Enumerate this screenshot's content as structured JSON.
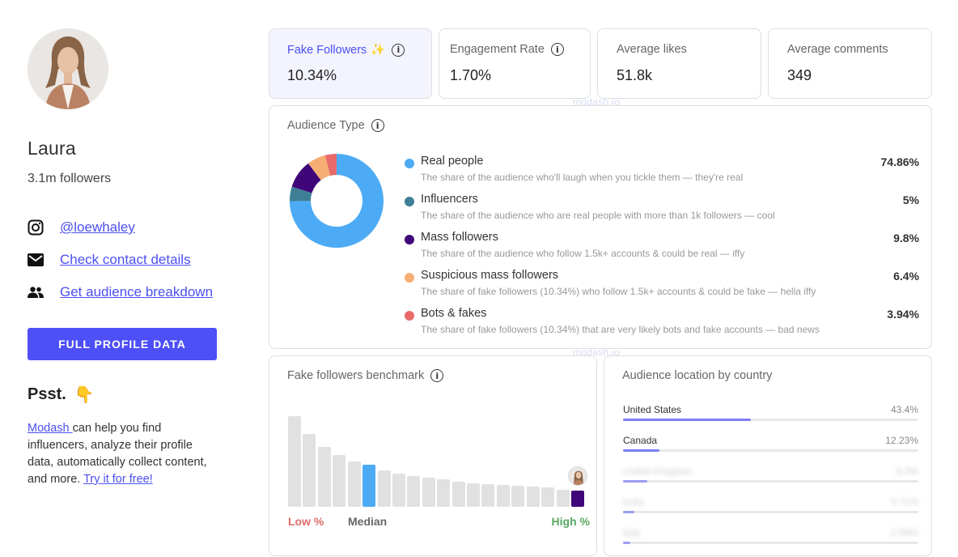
{
  "profile": {
    "name": "Laura",
    "followers": "3.1m followers",
    "instagram_handle": "@loewhaley",
    "contact_link": "Check contact details",
    "audience_link": "Get audience breakdown",
    "cta_label": "FULL PROFILE DATA"
  },
  "promo": {
    "heading": "Psst.",
    "hand_emoji": "👇",
    "brand_link": "Modash ",
    "body": "can help you find influencers, analyze their profile data, automatically collect content, and more. ",
    "try_link": "Try it for free!"
  },
  "stats": [
    {
      "label": "Fake Followers",
      "suffix": "✨",
      "value": "10.34%"
    },
    {
      "label": "Engagement Rate",
      "value": "1.70%"
    },
    {
      "label": "Average likes",
      "value": "51.8k"
    },
    {
      "label": "Average comments",
      "value": "349"
    }
  ],
  "watermark": "modash.io",
  "audience_type": {
    "title": "Audience Type",
    "items": [
      {
        "name": "Real people",
        "desc": "The share of the audience who'll laugh when you tickle them — they're real",
        "pct": "74.86%",
        "value": 74.86,
        "color": "#4dabf5"
      },
      {
        "name": "Influencers",
        "desc": "The share of the audience who are real people with more than 1k followers — cool",
        "pct": "5%",
        "value": 5,
        "color": "#3f7f96"
      },
      {
        "name": "Mass followers",
        "desc": "The share of the audience who follow 1.5k+ accounts & could be real — iffy",
        "pct": "9.8%",
        "value": 9.8,
        "color": "#3f067a"
      },
      {
        "name": "Suspicious mass followers",
        "desc": "The share of fake followers (10.34%) who follow 1.5k+ accounts & could be fake — hella iffy",
        "pct": "6.4%",
        "value": 6.4,
        "color": "#f7ae74"
      },
      {
        "name": "Bots & fakes",
        "desc": "The share of fake followers (10.34%) that are very likely bots and fake accounts — bad news",
        "pct": "3.94%",
        "value": 3.94,
        "color": "#e86a6a"
      }
    ]
  },
  "benchmark": {
    "title": "Fake followers benchmark",
    "low_label": "Low %",
    "median_label": "Median",
    "high_label": "High %",
    "bar_levels": [
      1.0,
      0.8,
      0.66,
      0.57,
      0.5,
      0.44,
      0.4,
      0.37,
      0.34,
      0.32,
      0.3,
      0.28,
      0.26,
      0.25,
      0.24,
      0.23,
      0.22,
      0.21,
      0.19,
      0.18
    ],
    "median_index": 5,
    "highlight_index": 19,
    "median_color": "#4dabf5",
    "highlight_color": "#3f067a"
  },
  "location": {
    "title": "Audience location by country",
    "items": [
      {
        "name": "United States",
        "pct": "43.4%",
        "value": 43.4
      },
      {
        "name": "Canada",
        "pct": "12.23%",
        "value": 12.23
      },
      {
        "name": "United Kingdom",
        "pct": "8.3%",
        "value": 8.3
      },
      {
        "name": "India",
        "pct": "3.71%",
        "value": 3.71
      },
      {
        "name": "Italy",
        "pct": "2.59%",
        "value": 2.59
      }
    ]
  }
}
